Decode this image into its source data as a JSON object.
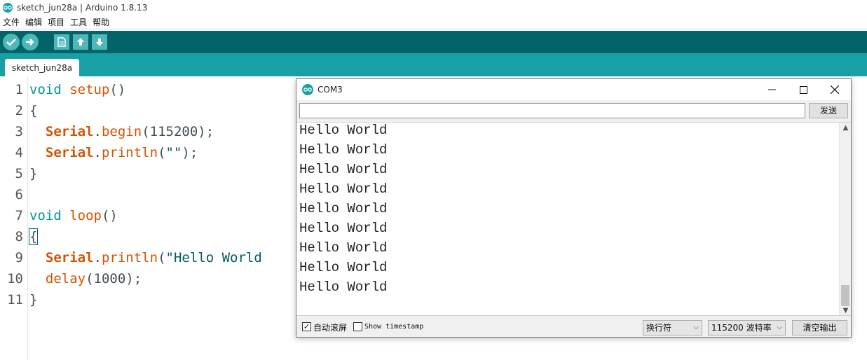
{
  "window": {
    "title": "sketch_jun28a | Arduino 1.8.13"
  },
  "menu": [
    "文件",
    "编辑",
    "项目",
    "工具",
    "帮助"
  ],
  "toolbar": {
    "buttons": [
      "verify-icon",
      "upload-icon",
      "new-icon",
      "open-icon",
      "save-icon"
    ]
  },
  "tabs": [
    {
      "label": "sketch_jun28a"
    }
  ],
  "editor": {
    "line_numbers": [
      "1",
      "2",
      "3",
      "4",
      "5",
      "6",
      "7",
      "8",
      "9",
      "10",
      "11"
    ],
    "lines": [
      {
        "kw": "void",
        "fn": "setup",
        "rest": "()"
      },
      {
        "text": "{"
      },
      {
        "cls": "Serial",
        "dot": ".",
        "fn": "begin",
        "open": "(",
        "num": "115200",
        "close": ");"
      },
      {
        "cls": "Serial",
        "dot": ".",
        "fn": "println",
        "open": "(",
        "str": "\"\"",
        "close": ");"
      },
      {
        "text": "}"
      },
      {
        "text": ""
      },
      {
        "kw": "void",
        "fn": "loop",
        "rest": "()"
      },
      {
        "text": "{"
      },
      {
        "cls": "Serial",
        "dot": ".",
        "fn": "println",
        "open": "(",
        "str": "\"Hello World"
      },
      {
        "fn": "delay",
        "open": "(",
        "num": "1000",
        "close": ");"
      },
      {
        "text": "}"
      }
    ]
  },
  "serial_monitor": {
    "title": "COM3",
    "input_value": "",
    "send_label": "发送",
    "output": [
      "Hello World",
      "Hello World",
      "Hello World",
      "Hello World",
      "Hello World",
      "Hello World",
      "Hello World",
      "Hello World",
      "Hello World"
    ],
    "autoscroll_label": "自动滚屏",
    "autoscroll_checked": "✓",
    "timestamp_label": "Show timestamp",
    "line_ending": "换行符",
    "baud_rate": "115200 波特率",
    "clear_label": "清空输出"
  }
}
